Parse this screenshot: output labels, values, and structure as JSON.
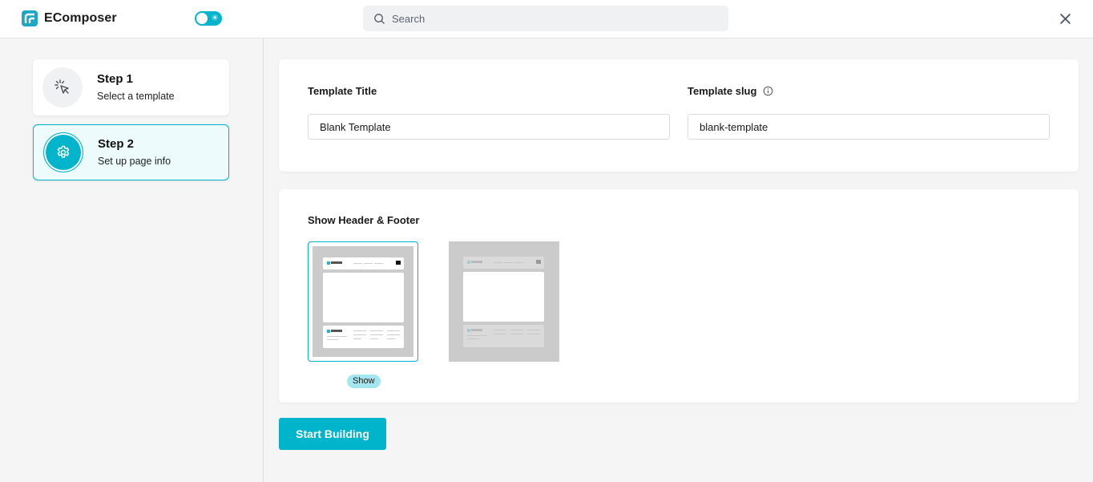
{
  "app": {
    "name": "EComposer",
    "brand_color": "#00b4cc"
  },
  "topbar": {
    "search_placeholder": "Search",
    "theme_toggle_icon": "sun-icon",
    "close_icon": "close-icon"
  },
  "sidebar": {
    "steps": [
      {
        "title": "Step 1",
        "subtitle": "Select a template",
        "icon": "cursor-click-icon",
        "active": false
      },
      {
        "title": "Step 2",
        "subtitle": "Set up page info",
        "icon": "gear-icon",
        "active": true
      }
    ]
  },
  "form": {
    "title_label": "Template Title",
    "title_value": "Blank Template",
    "slug_label": "Template slug",
    "slug_value": "blank-template"
  },
  "header_footer": {
    "label": "Show Header & Footer",
    "preview_brand": "EComposer",
    "options": [
      {
        "id": "show",
        "selected": true,
        "badge": "Show"
      },
      {
        "id": "hide",
        "selected": false
      }
    ]
  },
  "actions": {
    "start_label": "Start Building"
  }
}
